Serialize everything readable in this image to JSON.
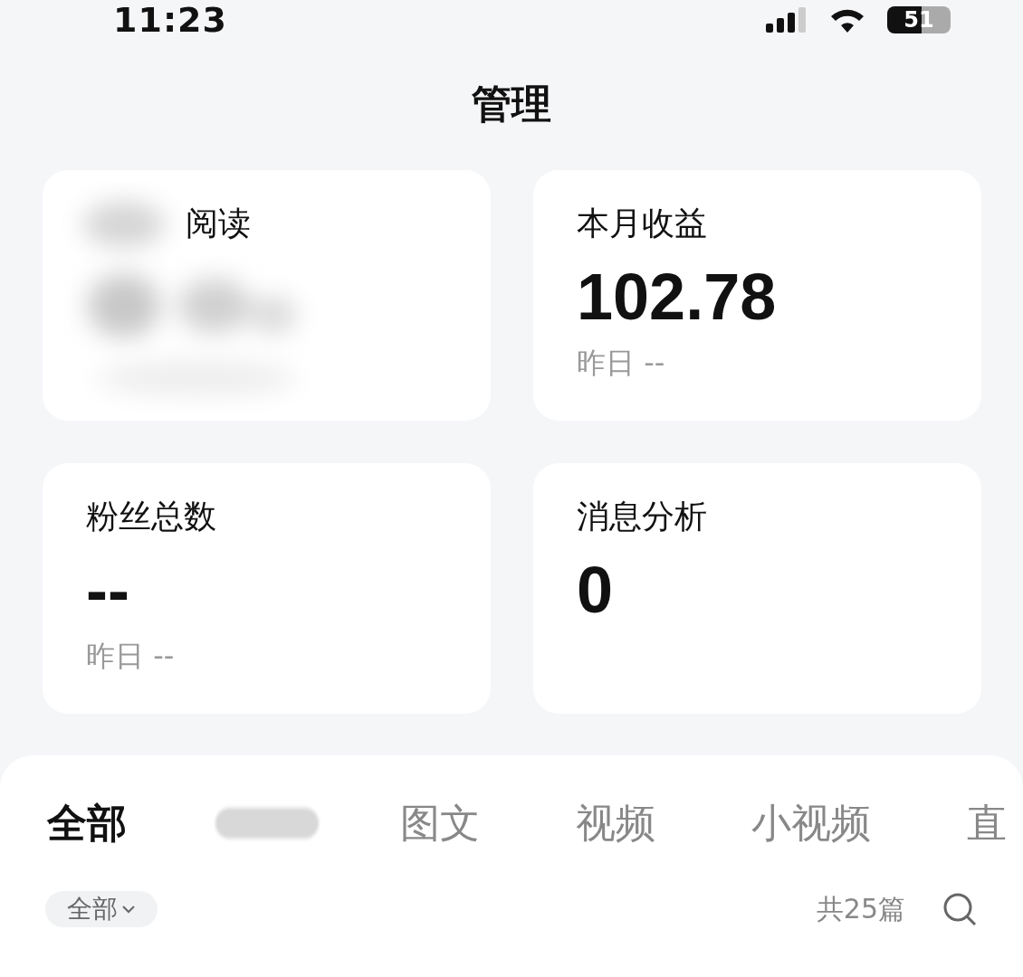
{
  "status_bar": {
    "time": "11:23",
    "battery": "51"
  },
  "title": "管理",
  "cards": [
    {
      "label": "阅读",
      "blurred": true
    },
    {
      "label": "本月收益",
      "value": "102.78",
      "sub": "昨日 --",
      "blurred": false
    },
    {
      "label": "粉丝总数",
      "value": "--",
      "sub": "昨日 --",
      "blurred": false
    },
    {
      "label": "消息分析",
      "value": "0",
      "blurred": false
    }
  ],
  "tabs": [
    {
      "label": "全部",
      "selected": true,
      "blurred": false
    },
    {
      "blurred": true,
      "selected": false
    },
    {
      "label": "图文",
      "selected": false,
      "blurred": false
    },
    {
      "label": "视频",
      "selected": false,
      "blurred": false
    },
    {
      "label": "小视频",
      "selected": false,
      "blurred": false
    },
    {
      "label": "直",
      "selected": false,
      "blurred": false
    }
  ],
  "filter": {
    "label": "全部",
    "count": "共25篇"
  }
}
